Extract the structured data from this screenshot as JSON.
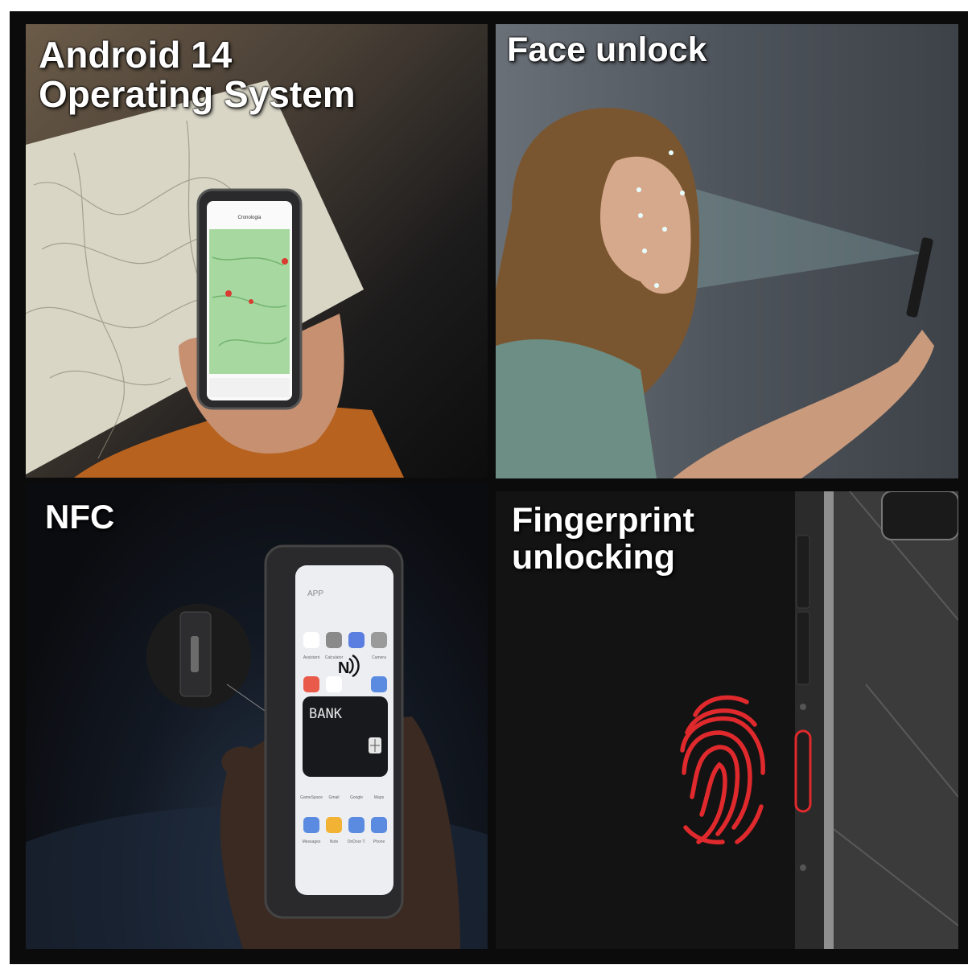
{
  "panels": {
    "android": {
      "title_line1": "Android 14",
      "title_line2": "Operating System",
      "map_label": "Cronologia"
    },
    "face": {
      "title": "Face unlock"
    },
    "nfc": {
      "title": "NFC",
      "card_text": "BANK",
      "app_header": "APP",
      "app_labels": [
        "Assistant",
        "Calculator",
        "",
        "Camera"
      ],
      "app_labels_row2": [
        "GameSpace",
        "Gmail",
        "Google",
        "Maps"
      ],
      "app_labels_row3": [
        "Messages",
        "Note",
        "OnDoor T.",
        "Phone"
      ]
    },
    "fingerprint": {
      "title_line1": "Fingerprint",
      "title_line2": "unlocking"
    }
  },
  "colors": {
    "fingerprint_red": "#e0292c",
    "map_green": "#9ed49a",
    "page_bg": "#0b0b0b"
  }
}
